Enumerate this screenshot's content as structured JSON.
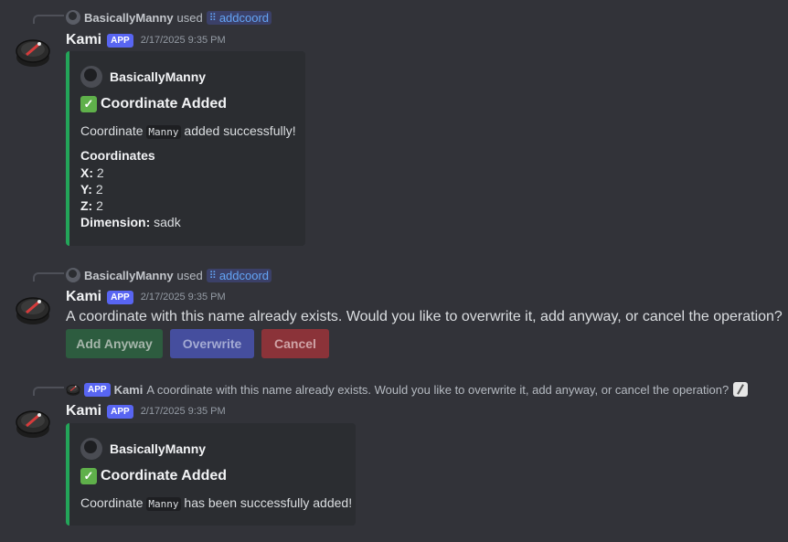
{
  "messages": [
    {
      "reply": {
        "user": "BasicallyManny",
        "used": "used",
        "command": "addcoord"
      },
      "author": "Kami",
      "badge": "APP",
      "timestamp": "2/17/2025 9:35 PM",
      "embed": {
        "author": "BasicallyManny",
        "title": "Coordinate Added",
        "desc_prefix": "Coordinate",
        "desc_code": "Manny",
        "desc_suffix": "added successfully!",
        "field_name": "Coordinates",
        "fields": [
          {
            "label": "X:",
            "value": "2"
          },
          {
            "label": "Y:",
            "value": "2"
          },
          {
            "label": "Z:",
            "value": "2"
          },
          {
            "label": "Dimension:",
            "value": "sadk"
          }
        ],
        "accent": "#23a559"
      }
    },
    {
      "reply": {
        "user": "BasicallyManny",
        "used": "used",
        "command": "addcoord"
      },
      "author": "Kami",
      "badge": "APP",
      "timestamp": "2/17/2025 9:35 PM",
      "content": "A coordinate with this name already exists. Would you like to overwrite it, add anyway, or cancel the operation?",
      "buttons": [
        {
          "label": "Add Anyway",
          "style": "success",
          "color": "#2d5c3f"
        },
        {
          "label": "Overwrite",
          "style": "primary",
          "color": "#454e9e"
        },
        {
          "label": "Cancel",
          "style": "danger",
          "color": "#8b3339"
        }
      ]
    },
    {
      "reply": {
        "badge": "APP",
        "user": "Kami",
        "text": "A coordinate with this name already exists. Would you like to overwrite it, add anyway, or cancel the operation?",
        "icon": "edit-icon"
      },
      "author": "Kami",
      "badge": "APP",
      "timestamp": "2/17/2025 9:35 PM",
      "embed": {
        "author": "BasicallyManny",
        "title": "Coordinate Added",
        "desc_prefix": "Coordinate",
        "desc_code": "Manny",
        "desc_suffix": "has been successfully added!",
        "accent": "#23a559"
      }
    }
  ]
}
